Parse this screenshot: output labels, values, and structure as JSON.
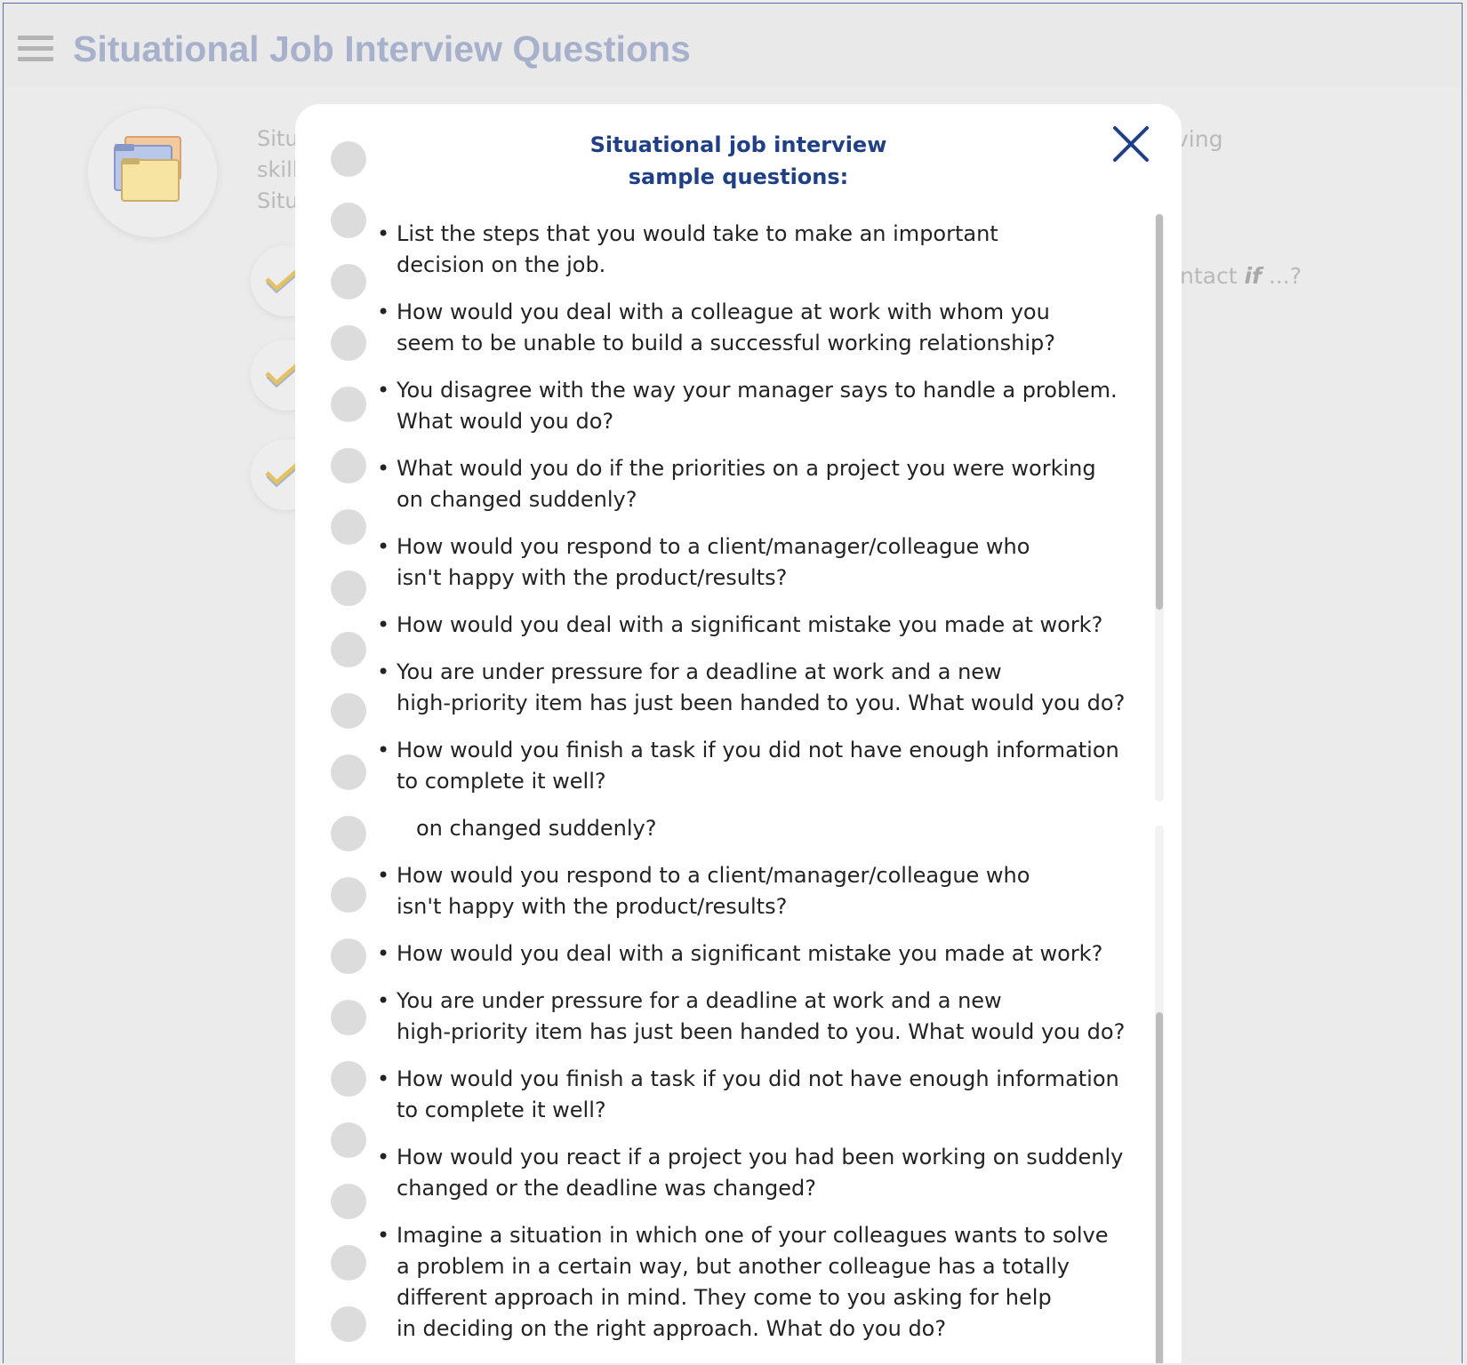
{
  "header": {
    "title": "Situational Job Interview Questions",
    "menu_icon": "hamburger-menu-icon"
  },
  "background": {
    "hero_icon": "folders-icon",
    "intro_lines": [
      "Situ",
      "skill",
      "Situ"
    ],
    "intro_right": "ving",
    "contact_prefix": "ntact ",
    "contact_if": "if",
    "contact_suffix": " ...?",
    "check_icon": "checkmark-icon"
  },
  "modal": {
    "title_line1": "Situational job interview",
    "title_line2": "sample questions:",
    "close_icon": "close-icon",
    "bullet": "•",
    "questions_top": [
      {
        "l1": "List the steps that you would take to make an important",
        "l2": "decision on the job."
      },
      {
        "l1": "How would you deal with a colleague at work with whom you",
        "l2": "seem to be unable to build a successful working relationship?"
      },
      {
        "l1": "You disagree with the way your manager says to handle a problem.",
        "l2": "What would you do?"
      },
      {
        "l1": "What would you do if the priorities on a project you were working",
        "l2": "on changed suddenly?"
      },
      {
        "l1": "How would you respond to a client/manager/colleague who",
        "l2": "isn't happy with the product/results?"
      },
      {
        "l1": "How would you deal with a significant mistake you made at work?"
      },
      {
        "l1": "You are under pressure for a deadline at work and a new",
        "l2": "high-priority item has just been handed to you. What would you do?"
      },
      {
        "l1": "How would you finish a task if you did not have enough information",
        "l2": "to complete it well?"
      }
    ],
    "fragment": "on changed suddenly?",
    "questions_bottom": [
      {
        "l1": "How would you respond to a client/manager/colleague who",
        "l2": "isn't happy with the product/results?"
      },
      {
        "l1": "How would you deal with a significant mistake you made at work?"
      },
      {
        "l1": "You are under pressure for a deadline at work and a new",
        "l2": "high-priority item has just been handed to you. What would you do?"
      },
      {
        "l1": "How would you finish a task if you did not have enough information",
        "l2": "to complete it well?"
      },
      {
        "l1": "How would you react if a project you had been working on suddenly",
        "l2": "changed or the deadline was changed?"
      },
      {
        "l1": "Imagine a situation in which one of your colleagues wants to solve",
        "l2": "a problem in a certain way, but another colleague has a totally",
        "l3": "different approach in mind. They come to you asking for help",
        "l4": "in deciding on the right approach. What do you do?"
      }
    ]
  }
}
